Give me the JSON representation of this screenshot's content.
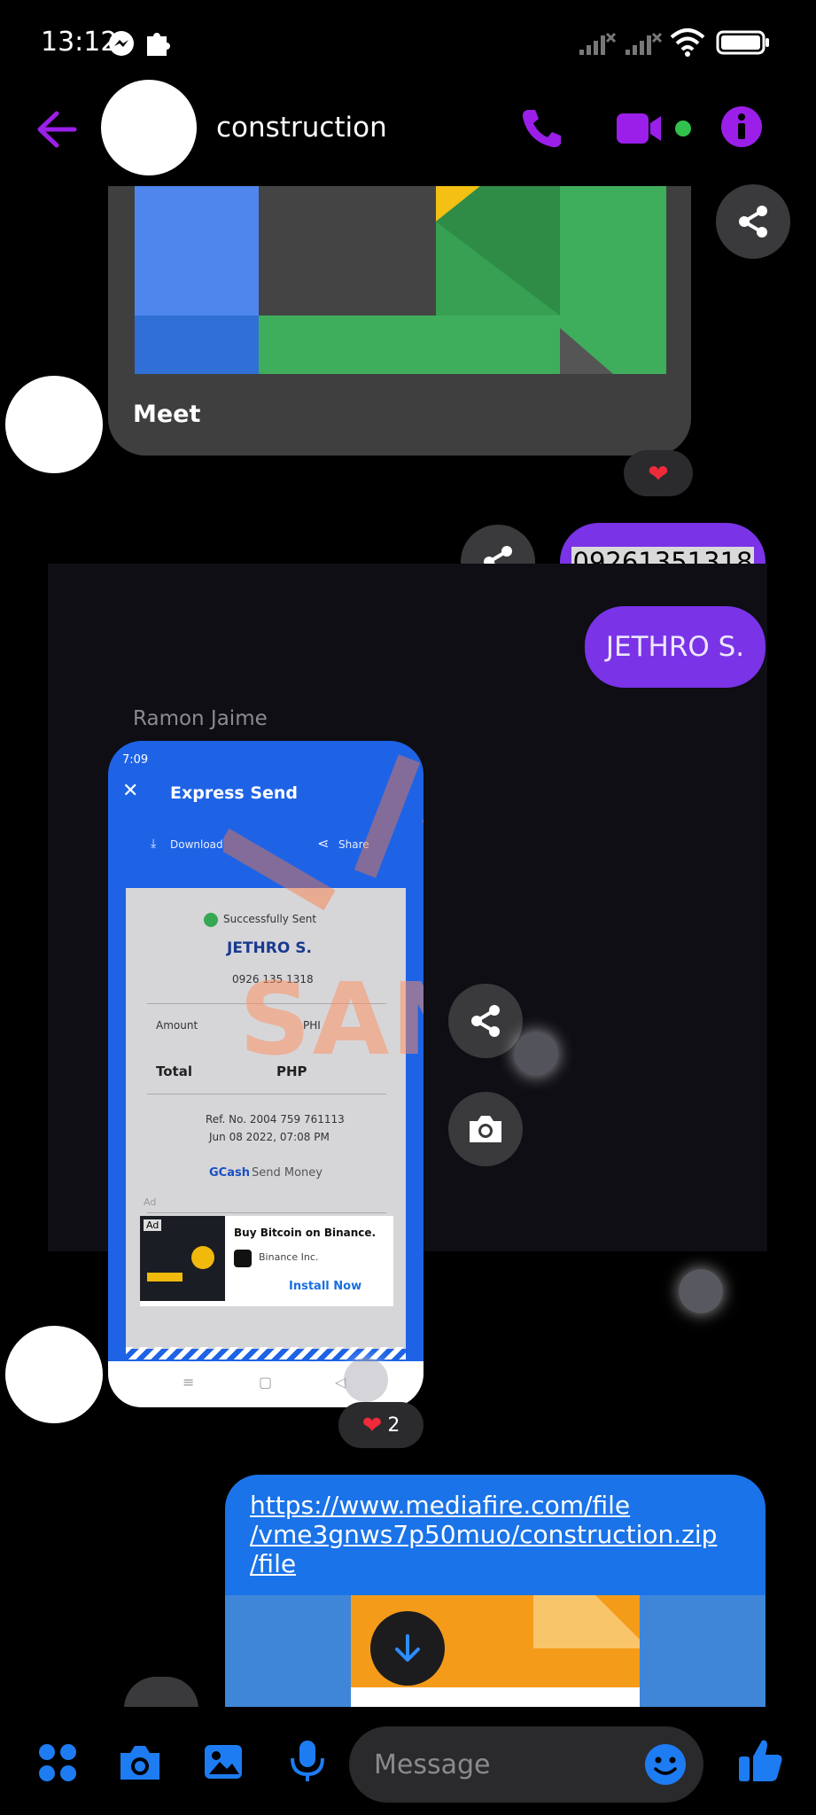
{
  "status_bar": {
    "time": "13:12"
  },
  "header": {
    "title": "construction"
  },
  "messages": {
    "meet_card": {
      "label": "Meet",
      "reaction": "❤️"
    },
    "phone_number": "09261351318",
    "recipient_name": "JETHRO S.",
    "sender_name": "Ramon Jaime",
    "screenshot": {
      "status_time": "7:09",
      "title": "Express Send",
      "download_label": "Download",
      "share_label": "Share",
      "status": "Successfully Sent",
      "name": "JETHRO S.",
      "number": "0926 135 1318",
      "amount_label": "Amount",
      "amount_currency": "PHI",
      "total_label": "Total",
      "total_currency": "PHP",
      "ref": "Ref. No. 2004 759 761113",
      "date": "Jun 08 2022, 07:08 PM",
      "brand": "GCash",
      "brand_suffix": "Send Money",
      "ad_label": "Ad",
      "ad_badge": "Ad",
      "ad_title": "Buy Bitcoin on Binance.",
      "ad_advertiser": "Binance Inc.",
      "ad_cta": "Install Now",
      "watermark": "SANARA"
    },
    "screenshot_reaction": {
      "emoji": "❤️",
      "count": "2"
    },
    "link": {
      "line1": "https://www.mediafire.com/file",
      "line2": "/vme3gnws7p50muo/construction.zip",
      "line3": "/file"
    }
  },
  "composer": {
    "placeholder": "Message"
  },
  "colors": {
    "accent_purple": "#9b1fe8",
    "bubble_purple": "#7a33e6",
    "messenger_blue": "#1e7cf2",
    "link_bubble": "#1a73e8"
  }
}
